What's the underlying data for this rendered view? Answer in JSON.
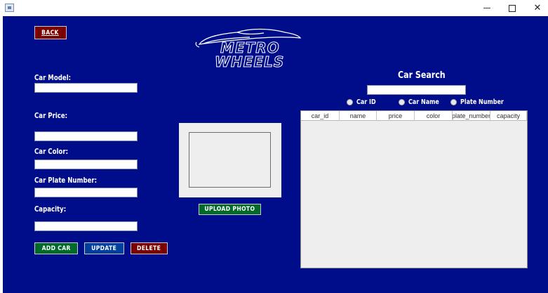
{
  "window": {
    "minimize_glyph": "—",
    "close_glyph": "✕"
  },
  "logo": {
    "line1": "METRO",
    "line2": "WHEELS"
  },
  "form": {
    "back_label": "BACK",
    "car_model_label": "Car Model:",
    "car_model_value": "",
    "car_price_label": "Car Price:",
    "car_price_value": "",
    "car_color_label": "Car Color:",
    "car_color_value": "",
    "plate_label": "Car Plate Number:",
    "plate_value": "",
    "capacity_label": "Capacity:",
    "capacity_value": "",
    "add_label": "ADD CAR",
    "update_label": "UPDATE",
    "delete_label": "DELETE"
  },
  "photo": {
    "upload_label": "UPLOAD PHOTO"
  },
  "search": {
    "title": "Car Search",
    "query": "",
    "options": [
      "Car ID",
      "Car Name",
      "Plate Number"
    ]
  },
  "table": {
    "columns": [
      "car_id",
      "name",
      "price",
      "color",
      "plate_number",
      "capacity"
    ],
    "rows": []
  },
  "colors": {
    "background": "#000d8b",
    "back_button": "#7a0000",
    "add_button": "#006a2a",
    "update_button": "#003f9e",
    "delete_button": "#7a0000",
    "upload_button": "#006a2a"
  }
}
